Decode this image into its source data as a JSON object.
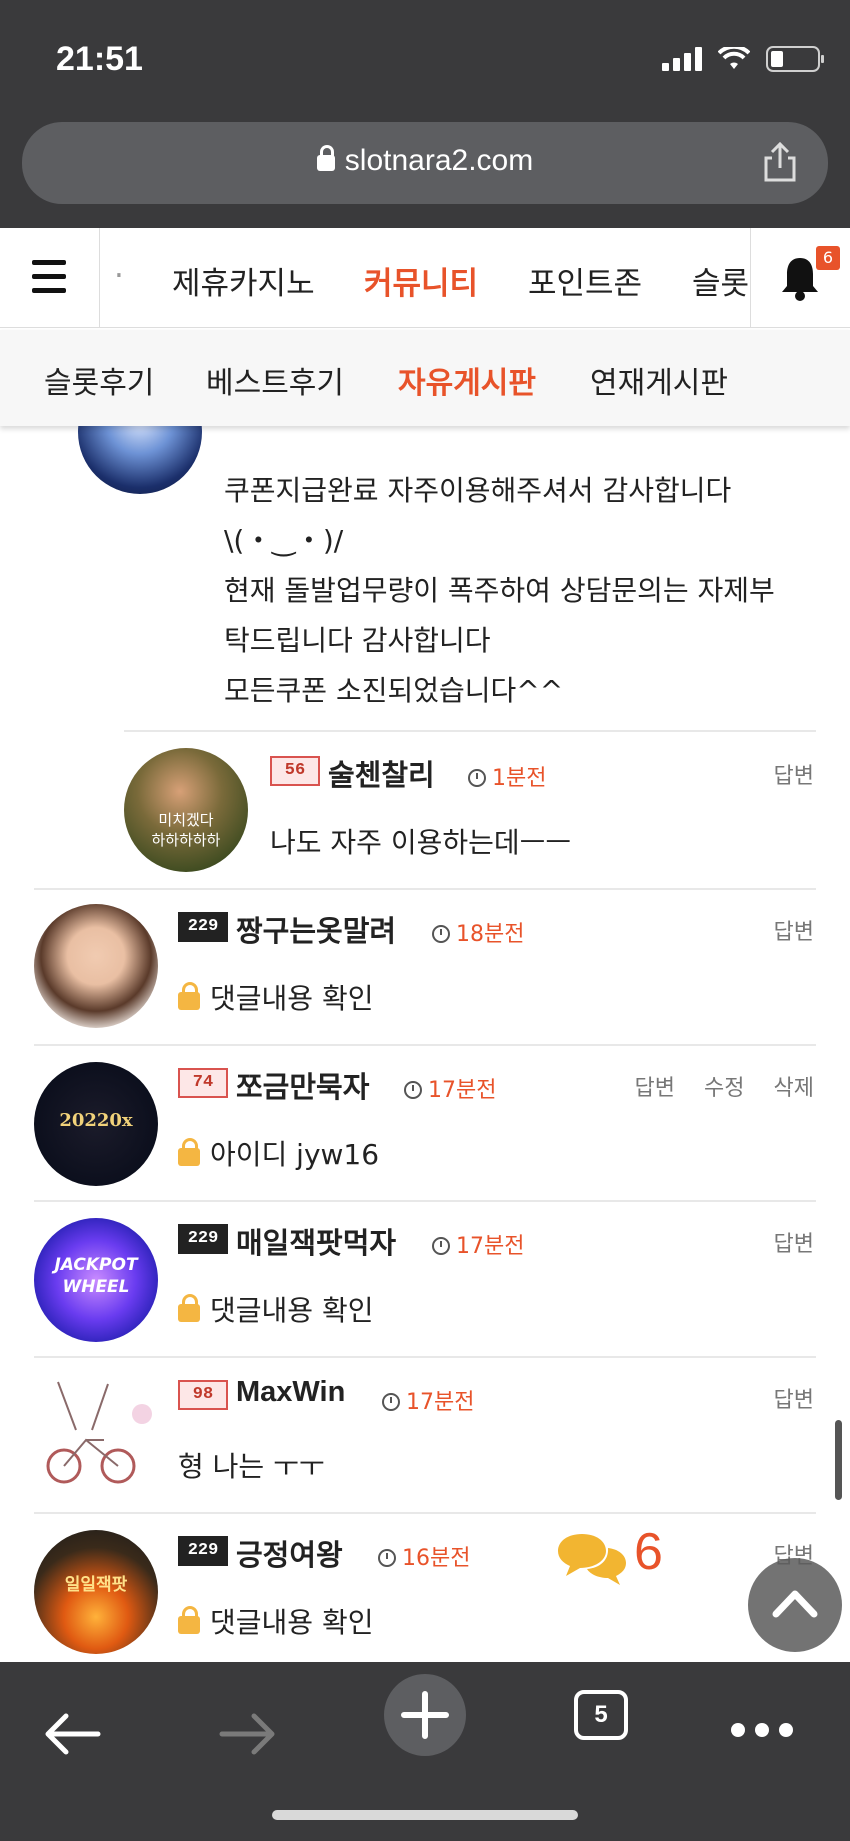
{
  "status_bar": {
    "time": "21:51"
  },
  "browser": {
    "url": "slotnara2.com",
    "tab_count": "5"
  },
  "site_nav": {
    "items": [
      {
        "label": "제휴카지노"
      },
      {
        "label": "커뮤니티",
        "active": true
      },
      {
        "label": "포인트존"
      },
      {
        "label": "슬롯"
      }
    ],
    "notification_count": "6"
  },
  "sub_nav": {
    "items": [
      {
        "label": "슬롯후기"
      },
      {
        "label": "베스트후기"
      },
      {
        "label": "자유게시판",
        "active": true
      },
      {
        "label": "연재게시판"
      }
    ]
  },
  "comments": [
    {
      "lines": [
        "쿠폰지급완료 자주이용해주셔서 감사합니다",
        "\\(・‿・)/",
        "현재 돌발업무량이 폭주하여 상담문의는 자제부",
        "탁드립니다 감사합니다",
        "모든쿠폰 소진되었습니다^^"
      ]
    },
    {
      "level": "56",
      "name": "술첸찰리",
      "time": "1분전",
      "body": "나도 자주 이용하는데ㅡㅡ",
      "actions": [
        "답변"
      ],
      "reply": true
    },
    {
      "level": "229",
      "name": "짱구는옷말려",
      "time": "18분전",
      "body": "댓글내용 확인",
      "locked": true,
      "actions": [
        "답변"
      ]
    },
    {
      "level": "74",
      "name": "쪼금만묵자",
      "time": "17분전",
      "body": "아이디 jyw16",
      "locked": true,
      "actions": [
        "답변",
        "수정",
        "삭제"
      ]
    },
    {
      "level": "229",
      "name": "매일잭팟먹자",
      "time": "17분전",
      "body": "댓글내용 확인",
      "locked": true,
      "actions": [
        "답변"
      ]
    },
    {
      "level": "98",
      "name": "MaxWin",
      "time": "17분전",
      "body": "형 나는 ㅜㅜ",
      "actions": [
        "답변"
      ]
    },
    {
      "level": "229",
      "name": "긍정여왕",
      "time": "16분전",
      "body": "댓글내용 확인",
      "locked": true,
      "actions": [
        "답변"
      ]
    }
  ],
  "avatar_texts": {
    "c1": "미치겠다\n하하하하하",
    "c3": "20220x",
    "c4": "JACKPOT WHEEL",
    "c6": "일일잭팟"
  },
  "comment_count": "6",
  "colors": {
    "accent": "#e8532a",
    "chrome": "#3a3a3c"
  }
}
